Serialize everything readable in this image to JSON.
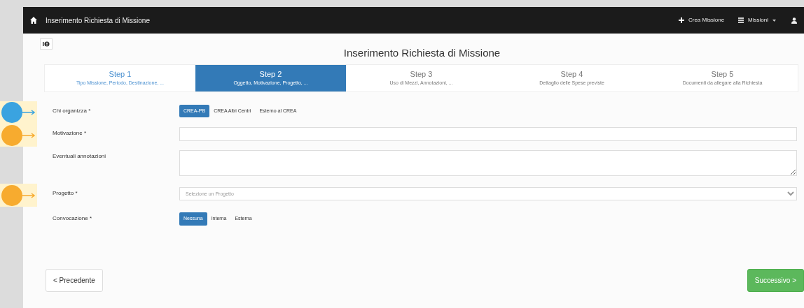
{
  "navbar": {
    "title": "Inserimento Richiesta di Missione",
    "links": [
      {
        "label": "Crea Missione",
        "dropdown": false
      },
      {
        "label": "Missioni",
        "dropdown": true
      }
    ]
  },
  "page_title": "Inserimento Richiesta di Missione",
  "steps": [
    {
      "title": "Step 1",
      "subtitle": "Tipo Missione, Periodo, Destinazione, ...",
      "selected": false,
      "link": true
    },
    {
      "title": "Step 2",
      "subtitle": "Oggetto, Motivazione, Progetto, ...",
      "selected": true,
      "link": true
    },
    {
      "title": "Step 3",
      "subtitle": "Uso di Mezzi, Annotazioni, ...",
      "selected": false,
      "link": false
    },
    {
      "title": "Step 4",
      "subtitle": "Dettaglio delle Spese previste",
      "selected": false,
      "link": false
    },
    {
      "title": "Step 5",
      "subtitle": "Documenti da allegare alla Richiesta",
      "selected": false,
      "link": false
    }
  ],
  "form": [
    {
      "label": "Chi organizza *",
      "kind": "buttons",
      "marker": {
        "color": "#3aa3e0"
      },
      "options": [
        {
          "label": "CREA-PB",
          "selected": true
        },
        {
          "label": "CREA Altri Centri",
          "selected": false
        },
        {
          "label": "Esterno al CREA",
          "selected": false
        }
      ]
    },
    {
      "label": "Motivazione *",
      "kind": "input",
      "marker": {
        "color": "#f7ab2f"
      }
    },
    {
      "label": "Eventuali annotazioni",
      "kind": "textarea"
    },
    {
      "label": "Progetto *",
      "kind": "select",
      "marker": {
        "color": "#f7ab2f"
      },
      "placeholder": "Selezione un Progetto"
    },
    {
      "label": "Convocazione *",
      "kind": "buttons",
      "options": [
        {
          "label": "Nessuna",
          "selected": true
        },
        {
          "label": "Interna",
          "selected": false
        },
        {
          "label": "Esterna",
          "selected": false
        }
      ]
    }
  ],
  "buttons": [
    {
      "label": "< Precedente",
      "kind": "secondary"
    },
    {
      "label": "Successivo >",
      "kind": "primary"
    }
  ]
}
